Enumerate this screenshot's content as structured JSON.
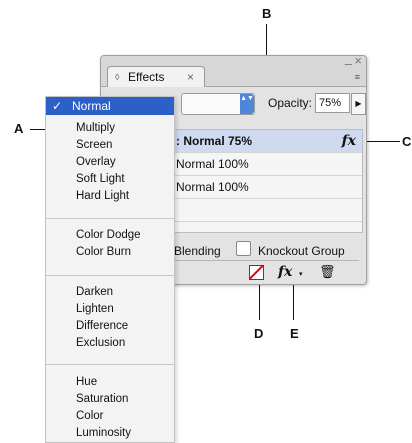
{
  "panel": {
    "tab_icon": "◊",
    "tab_title": "Effects",
    "tab_close": "×",
    "window_min": "–",
    "window_close": "×",
    "menu_icon": "≡",
    "blend_select_arrows": "▲▼",
    "opacity_label": "Opacity:",
    "opacity_value": "75%",
    "opacity_stepper": "▶",
    "layers": [
      {
        "text": ": Normal 75%",
        "fx": "fx",
        "selected": true
      },
      {
        "text": "Normal 100%",
        "fx": ""
      },
      {
        "text": "Normal 100%",
        "fx": ""
      },
      {
        "text": "",
        "fx": ""
      }
    ],
    "isolate_label": "Blending",
    "knockout_label": "Knockout Group",
    "fx_icon": "fx",
    "fx_caret": "▾",
    "trash_icon": "🗑"
  },
  "blend_menu": {
    "selected": "Normal",
    "check": "✓",
    "groups": [
      [
        "Multiply",
        "Screen",
        "Overlay",
        "Soft Light",
        "Hard Light"
      ],
      [
        "Color Dodge",
        "Color Burn"
      ],
      [
        "Darken",
        "Lighten",
        "Difference",
        "Exclusion"
      ],
      [
        "Hue",
        "Saturation",
        "Color",
        "Luminosity"
      ]
    ]
  },
  "callouts": {
    "A": "A",
    "B": "B",
    "C": "C",
    "D": "D",
    "E": "E"
  },
  "colors": {
    "menu_highlight": "#2d5fc8",
    "select_arrows": "#4f86d9",
    "selected_row": "#cfdaf0",
    "clear_slash": "#dd0000"
  }
}
